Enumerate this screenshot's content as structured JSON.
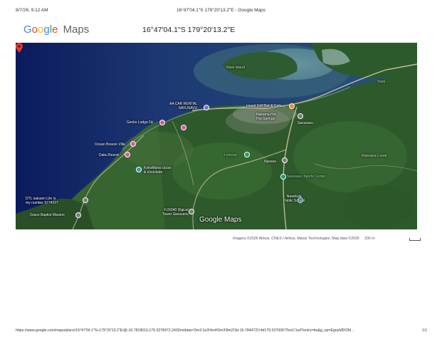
{
  "header": {
    "print_date": "8/7/26, 9:12 AM",
    "print_title": "16°47'04.1\"S 179°20'13.2\"E - Google Maps"
  },
  "logo": {
    "text": "Google Maps",
    "letters": [
      "G",
      "o",
      "o",
      "g",
      "l",
      "e"
    ],
    "letter_colors": [
      "#4285F4",
      "#EA4335",
      "#FBBC05",
      "#4285F4",
      "#34A853",
      "#EA4335"
    ],
    "maps_word": "Maps",
    "maps_color": "#5f6368"
  },
  "coordinates": "16°47'04.1\"S 179°20'13.2\"E",
  "map": {
    "places": [
      {
        "name": "Nawi Island",
        "color": "faint"
      },
      {
        "name": "Yaroi",
        "color": "faint"
      },
      {
        "name": "AA CAR RENTAL\nSAVUSAVU",
        "color": "white",
        "pin": "purple"
      },
      {
        "name": "Island Grill Bar & Cafe",
        "color": "white",
        "pin": "orange"
      },
      {
        "name": "Nakama Hot\nHot Springs",
        "color": "white",
        "pin": "gray"
      },
      {
        "name": "Gecko Lodge Fiji",
        "color": "white",
        "pin": "pink"
      },
      {
        "name": "Savusavu",
        "color": "white"
      },
      {
        "name": "Ocean Breeze Villa",
        "color": "white",
        "pin": "pink"
      },
      {
        "name": "Lookout",
        "color": "green",
        "pin": "green"
      },
      {
        "name": "Daku Resort",
        "color": "white",
        "pin": "pink"
      },
      {
        "name": "Nasasa",
        "color": "white",
        "pin": "gray"
      },
      {
        "name": "Wainaloa Creek",
        "color": "faint"
      },
      {
        "name": "KokoMana cacao\n& chocolate",
        "color": "white",
        "pin": "teal"
      },
      {
        "name": "Savusavu Sports Center",
        "color": "green",
        "pin": "green"
      },
      {
        "name": "Nasekula\nPublic School",
        "color": "white",
        "pin": "blue"
      },
      {
        "name": "DTL salusen Lite is\nmy number 9774227",
        "color": "white",
        "pin": "gray"
      },
      {
        "name": "Grace Baptist Mission",
        "color": "white",
        "pin": "gray"
      },
      {
        "name": "FJX040 Digicel\nTower Savusavu",
        "color": "white",
        "pin": "gray"
      }
    ],
    "watermark": "Google Maps"
  },
  "attribution": {
    "text": "Imagery ©2026 Airbus, CNES / Airbus, Maxar Technologies, Map data ©2026",
    "scale": "200 m"
  },
  "footer": {
    "url": "https://www.google.com/maps/place/16°47'04.1\"S+179°20'13.2\"E/@-16.7819516,179.3278472,2432m/data=!3m1!1e3!4m4!3m3!8m2!3d-16.7844721!4d179.3370067!5m1!1e4?entry=ttu&g_ep=EgoyMDI2M…",
    "page": "1/1"
  }
}
